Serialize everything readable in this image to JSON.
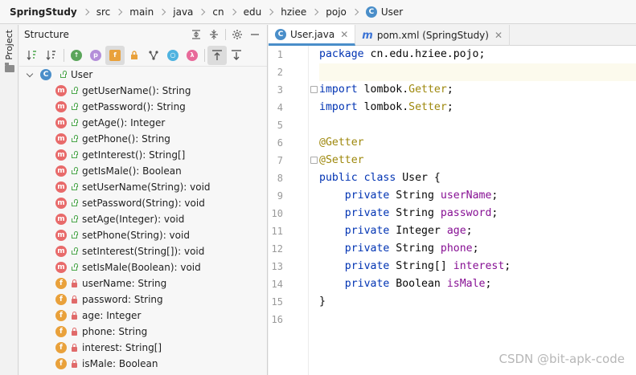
{
  "breadcrumb": [
    {
      "label": "SpringStudy"
    },
    {
      "label": "src"
    },
    {
      "label": "main"
    },
    {
      "label": "java"
    },
    {
      "label": "cn"
    },
    {
      "label": "edu"
    },
    {
      "label": "hziee"
    },
    {
      "label": "pojo"
    },
    {
      "label": "User",
      "icon": "class-icon"
    }
  ],
  "sidebar": {
    "project_label": "Project"
  },
  "structure": {
    "title": "Structure",
    "root": {
      "icon_letter": "C",
      "label": "User"
    },
    "methods": [
      "getUserName(): String",
      "getPassword(): String",
      "getAge(): Integer",
      "getPhone(): String",
      "getInterest(): String[]",
      "getIsMale(): Boolean",
      "setUserName(String): void",
      "setPassword(String): void",
      "setAge(Integer): void",
      "setPhone(String): void",
      "setInterest(String[]): void",
      "setIsMale(Boolean): void"
    ],
    "fields": [
      "userName: String",
      "password: String",
      "age: Integer",
      "phone: String",
      "interest: String[]",
      "isMale: Boolean"
    ]
  },
  "editor": {
    "tabs": [
      {
        "label": "User.java",
        "icon_letter": "C",
        "active": true
      },
      {
        "label": "pom.xml (SpringStudy)",
        "icon_letter": "m",
        "active": false
      }
    ],
    "line_numbers": [
      "1",
      "2",
      "3",
      "4",
      "5",
      "6",
      "7",
      "8",
      "9",
      "10",
      "11",
      "12",
      "13",
      "14",
      "15",
      "16"
    ],
    "code": {
      "l1_kw": "package",
      "l1_rest": " cn.edu.hziee.pojo;",
      "l3_kw": "import",
      "l3_rest": " lombok.",
      "l3_ann": "Getter",
      "l3_end": ";",
      "l4_kw": "import",
      "l4_rest": " lombok.",
      "l4_ann": "Setter",
      "l4_end": ";",
      "l6_ann": "@Getter",
      "l7_ann": "@Setter",
      "l8_kw": "public class",
      "l8_rest": " User {",
      "fields": [
        {
          "kw": "private",
          "type": " String ",
          "name": "userName",
          "end": ";"
        },
        {
          "kw": "private",
          "type": " String ",
          "name": "password",
          "end": ";"
        },
        {
          "kw": "private",
          "type": " Integer ",
          "name": "age",
          "end": ";"
        },
        {
          "kw": "private",
          "type": " String ",
          "name": "phone",
          "end": ";"
        },
        {
          "kw": "private",
          "type": " String[] ",
          "name": "interest",
          "end": ";"
        },
        {
          "kw": "private",
          "type": " Boolean ",
          "name": "isMale",
          "end": ";"
        }
      ],
      "l15": "}"
    }
  },
  "watermark": "CSDN @bit-apk-code",
  "colors": {
    "accent": "#4a8ec9",
    "method_icon": "#e86a6a",
    "field_icon": "#e9a13b",
    "keyword": "#0033b3",
    "annotation": "#9e880d",
    "field_name": "#871094"
  }
}
